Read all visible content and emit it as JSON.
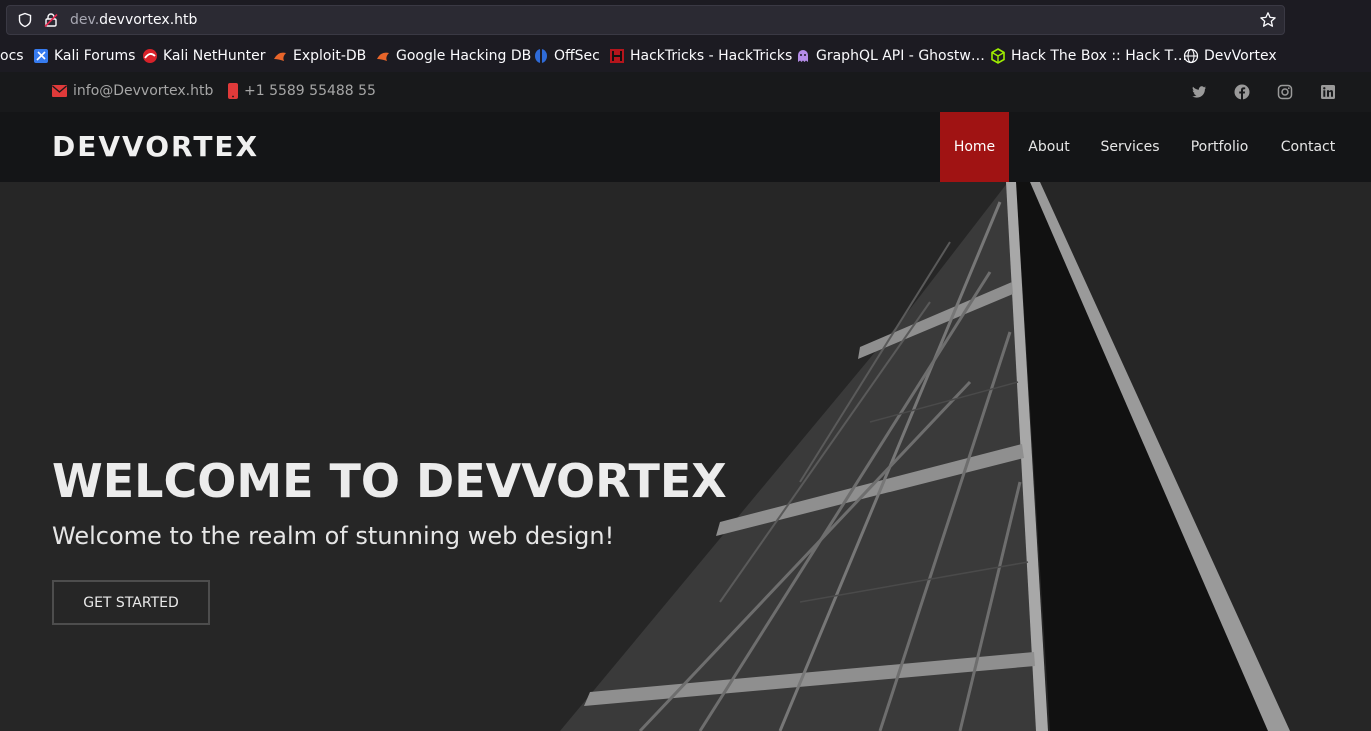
{
  "browser": {
    "url_prefix": "dev.",
    "url_domain": "devvortex.htb",
    "bookmarks": [
      {
        "label": "ocs",
        "icon": "partial-icon"
      },
      {
        "label": "Kali Forums",
        "icon": "kali-forums-icon"
      },
      {
        "label": "Kali NetHunter",
        "icon": "kali-nethunter-icon"
      },
      {
        "label": "Exploit-DB",
        "icon": "exploit-db-icon"
      },
      {
        "label": "Google Hacking DB",
        "icon": "ghdb-icon"
      },
      {
        "label": "OffSec",
        "icon": "offsec-icon"
      },
      {
        "label": "HackTricks - HackTricks",
        "icon": "hacktricks-icon"
      },
      {
        "label": "GraphQL API - Ghostw…",
        "icon": "ghost-icon"
      },
      {
        "label": "Hack The Box :: Hack T…",
        "icon": "htb-cube-icon"
      },
      {
        "label": "DevVortex",
        "icon": "globe-icon"
      }
    ]
  },
  "topbar": {
    "email": "info@Devvortex.htb",
    "phone": "+1 5589 55488 55",
    "social": [
      "twitter-icon",
      "facebook-icon",
      "instagram-icon",
      "linkedin-icon"
    ]
  },
  "nav": {
    "logo": "DEVVORTEX",
    "items": [
      "Home",
      "About",
      "Services",
      "Portfolio",
      "Contact"
    ],
    "active": "Home"
  },
  "hero": {
    "title": "WELCOME TO DEVVORTEX",
    "subtitle": "Welcome to the realm of stunning web design!",
    "button": "GET STARTED"
  },
  "colors": {
    "accent": "#a01313",
    "email_icon": "#e03a3a",
    "phone_icon": "#e03a3a"
  }
}
